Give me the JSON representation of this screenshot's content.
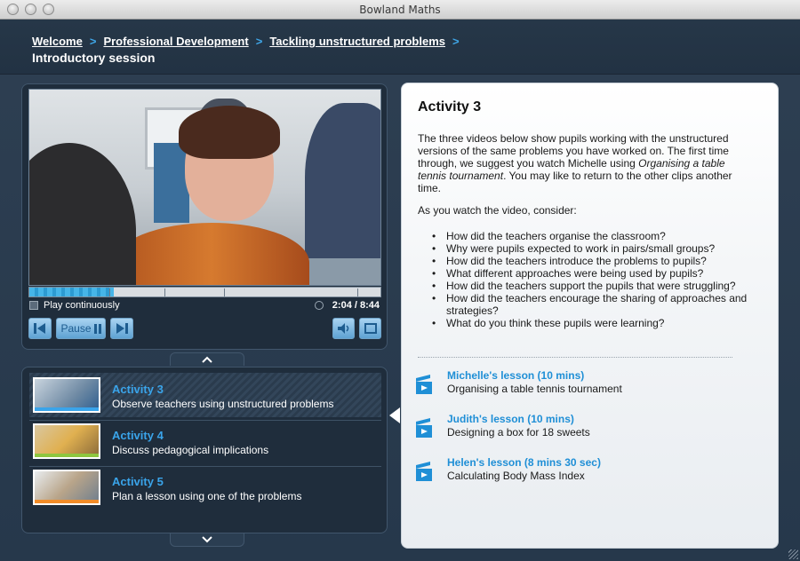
{
  "window": {
    "title": "Bowland Maths"
  },
  "breadcrumb": {
    "items": [
      "Welcome",
      "Professional Development",
      "Tackling unstructured problems"
    ],
    "separator": ">"
  },
  "page_title": "Introductory session",
  "player": {
    "play_continuously_label": "Play continuously",
    "timecode": "2:04 / 8:44",
    "progress_fraction": 0.24,
    "pause_label": "Pause"
  },
  "activities": [
    {
      "title": "Activity 3",
      "description": "Observe teachers using unstructured problems",
      "active": true,
      "thumb_accent": "#3aa4ea"
    },
    {
      "title": "Activity 4",
      "description": "Discuss pedagogical implications",
      "active": false,
      "thumb_accent": "#8ec63f"
    },
    {
      "title": "Activity 5",
      "description": "Plan a lesson using one of the problems",
      "active": false,
      "thumb_accent": "#f28c28"
    }
  ],
  "content": {
    "title": "Activity 3",
    "intro_part1": "The three videos below show pupils working with the unstructured versions of the same problems you have worked on. The first time through, we suggest you watch Michelle using ",
    "intro_emphasis": "Organising a table tennis tournament",
    "intro_part2": ". You may like to return to the other clips another time.",
    "consider": "As you watch the video, consider:",
    "questions": [
      "How did the teachers organise the classroom?",
      "Why were pupils expected to work in pairs/small groups?",
      "How did the teachers introduce the problems to pupils?",
      "What different approaches were being used by pupils?",
      "How did the teachers support the pupils that were struggling?",
      "How did the teachers encourage the sharing of approaches and strategies?",
      "What do you think these pupils were learning?"
    ],
    "lessons": [
      {
        "title": "Michelle's lesson (10 mins)",
        "subtitle": "Organising a table tennis tournament"
      },
      {
        "title": "Judith's lesson (10 mins)",
        "subtitle": "Designing a box for 18 sweets"
      },
      {
        "title": "Helen's lesson (8 mins 30 sec)",
        "subtitle": "Calculating Body Mass Index"
      }
    ]
  },
  "colors": {
    "accent": "#3aa4ea",
    "background": "#2a3a4c",
    "panel": "#1f2d3c"
  },
  "icons": {
    "up_tab": "chevron-up-icon",
    "down_tab": "chevron-down-icon",
    "prev": "skip-back-icon",
    "next": "skip-forward-icon",
    "volume": "volume-icon",
    "fullscreen": "fullscreen-icon",
    "lesson": "video-clip-icon"
  }
}
